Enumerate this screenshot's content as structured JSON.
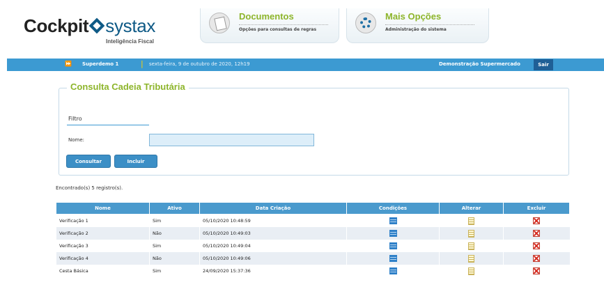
{
  "brand": {
    "name_part1": "Cockpit",
    "name_part2": "systax",
    "tagline": "Inteligência Fiscal"
  },
  "menu_tabs": [
    {
      "title": "Documentos",
      "subtitle": "Opções para consultas de regras",
      "icon": "document-icon"
    },
    {
      "title": "Mais Opções",
      "subtitle": "Administração do sistema",
      "icon": "gear-icon"
    }
  ],
  "topbar": {
    "arrow": "⏩",
    "user": "Superdemo 1",
    "separator": "|",
    "date": "sexta-feira, 9 de outubro de 2020, 12h19",
    "company": "Demonstração Supermercado",
    "logout_label": "Sair"
  },
  "form": {
    "title": "Consulta Cadeia Tributária",
    "filter_label": "Filtro",
    "name_label": "Nome:",
    "name_value": "",
    "search_button": "Consultar",
    "add_button": "Incluir"
  },
  "results": {
    "summary": "Encontrado(s) 5 registro(s).",
    "columns": [
      "Nome",
      "Ativo",
      "Data Criação",
      "Condições",
      "Alterar",
      "Excluir"
    ],
    "rows": [
      {
        "nome": "Verificação 1",
        "ativo": "Sim",
        "data": "05/10/2020 10:48:59"
      },
      {
        "nome": "Verificação 2",
        "ativo": "Não",
        "data": "05/10/2020 10:49:03"
      },
      {
        "nome": "Verificação 3",
        "ativo": "Sim",
        "data": "05/10/2020 10:49:04"
      },
      {
        "nome": "Verificação 4",
        "ativo": "Não",
        "data": "05/10/2020 10:49:06"
      },
      {
        "nome": "Cesta Básica",
        "ativo": "Sim",
        "data": "24/09/2020 15:37:36"
      }
    ]
  },
  "colors": {
    "brand_blue": "#0f5a86",
    "accent_green": "#8db52b",
    "bar_blue": "#3c9ad2"
  }
}
